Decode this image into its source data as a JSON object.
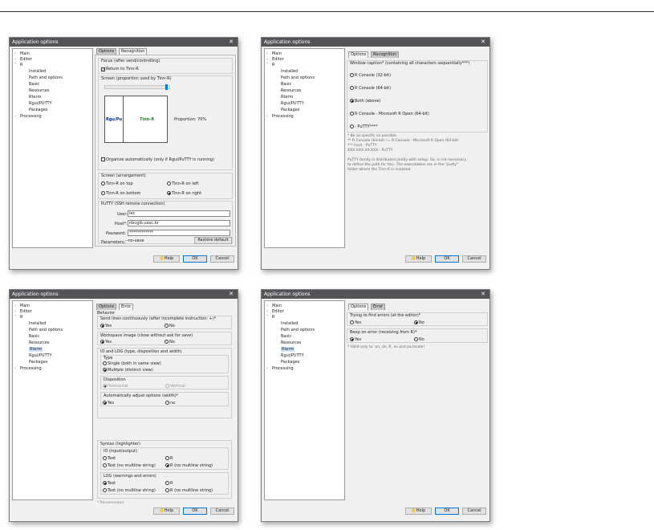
{
  "window_title": "Application options",
  "tree": {
    "main": "Main",
    "editor": "Editor",
    "r": "R",
    "installed": "Installed",
    "path_options": "Path and options",
    "basic": "Basic",
    "resources": "Resources",
    "rterm": "Rterm",
    "rgui_putty": "Rgui/PUTTY",
    "packages": "Packages",
    "processing": "Processing"
  },
  "footer": {
    "help": "Help",
    "ok": "OK",
    "cancel": "Cancel"
  },
  "w1": {
    "tab_options": "Options",
    "tab_recognition": "Recognition",
    "focus_group": "Focus (after send/controlling)",
    "return_to": "Return to Tinn-R",
    "screen_prop": "Screen (proportion used by Tinn-R)",
    "rgu_label": "Rgu/Pu",
    "tinn_label": "Tinn-R",
    "proportion": "Proportion: 70%",
    "organize": "Organize automatically (only if Rgui/PuTTY is running)",
    "screen_arr": "Screen (arrangement)",
    "tinn_top": "Tinn-R on top",
    "tinn_left": "Tinn-R on left",
    "tinn_bottom": "Tinn-R on bottom",
    "tinn_right": "Tinn-R on right",
    "putty_group": "PuTTY (SSH remote connection)",
    "user_label": "User:",
    "user_val": "lec",
    "host_label": "Host*:",
    "host_val": "nbcgib.uesc.br",
    "pass_label": "Password:",
    "pass_val": "************",
    "params_label": "Parameters:",
    "params_val": "--no-save",
    "restore": "Restore default"
  },
  "w2": {
    "tab_options": "Options",
    "tab_recognition": "Recognition",
    "window_caption": "Window caption* (containing all characters sequentially***)",
    "opt1": "R Console (32-bit)",
    "opt2": "R Console (64-bit)",
    "opt3": "Both (above)",
    "opt4": "R Console - Microsoft R Open (64-bit)",
    "opt5": "- PuTTY****",
    "note1": "*    Be as specific as possible",
    "note2": "**   R Console (64-bit)  !=  R Console - Microsoft R Open (64-bit)",
    "note3": "***  Host - PuTTY",
    "note4": "      XXX.XXX.XX.XXX - PuTTY",
    "para1": "PuTTY family is distributed jointly with setup. So, is not necessary",
    "para2": "to define the path for this. The executables are in the \"putty\"",
    "para3": "folder where the Tinn-R is installed."
  },
  "w3": {
    "tab_options": "Options",
    "tab_error": "Error",
    "behavior": "Behavior",
    "send_lines": "Send lines continuously (after incomplete instruction: +)*",
    "yes": "Yes",
    "no": "No",
    "workspace": "Workspace image (close without ask for save)",
    "io_log": "IO and LOG (type, disposition and width)",
    "type": "Type",
    "single": "Single (both in same view)",
    "multiple": "Multiple (distinct view)",
    "disposition": "Disposition",
    "horizontal": "Horizontal",
    "vertical": "Vertical",
    "auto_adjust": "Automatically adjust options (width)*",
    "no_lower": "no",
    "syntax": "Syntax (highlighter)",
    "io_input": "IO (input/output)",
    "text": "Text",
    "r_opt": "R",
    "text_nomulti": "Text (no multline string)",
    "r_nomulti": "R (no multline string)",
    "log_warn": "LOG (warnings and errors)",
    "recomended": "* Recomended"
  },
  "w4": {
    "tab_options": "Options",
    "tab_error": "Error",
    "trying": "Trying to find errors (at the editor)*",
    "yes": "Yes",
    "no": "No",
    "beep": "Beep on error (receiving from R)*",
    "valid": "* Valid only to: en, de, fr, es and pa locale!"
  }
}
